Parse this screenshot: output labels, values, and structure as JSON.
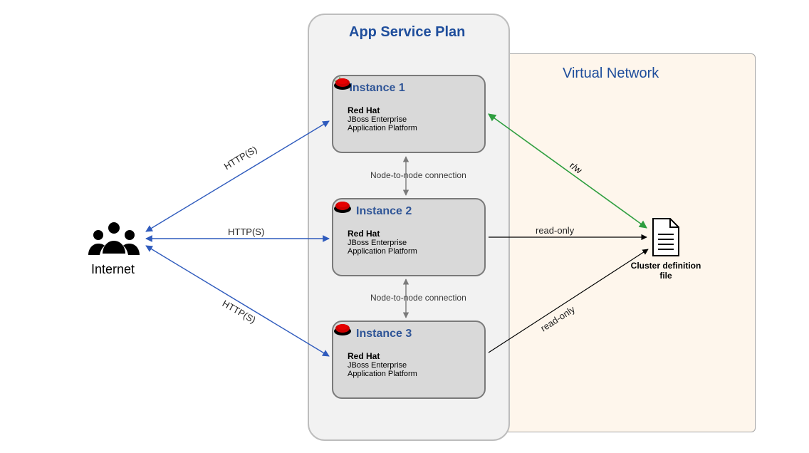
{
  "asp_title": "App Service Plan",
  "vn_title": "Virtual Network",
  "internet_label": "Internet",
  "instances": [
    {
      "title": "Instance 1",
      "vendor": "Red Hat",
      "product1": "JBoss Enterprise",
      "product2": "Application Platform"
    },
    {
      "title": "Instance 2",
      "vendor": "Red Hat",
      "product1": "JBoss Enterprise",
      "product2": "Application Platform"
    },
    {
      "title": "Instance 3",
      "vendor": "Red Hat",
      "product1": "JBoss Enterprise",
      "product2": "Application Platform"
    }
  ],
  "edges": {
    "http1": "HTTP(S)",
    "http2": "HTTP(S)",
    "http3": "HTTP(S)",
    "node_conn": "Node-to-node connection",
    "rw": "r/w",
    "ro1": "read-only",
    "ro2": "read-only"
  },
  "cluster_file_label": "Cluster definition file"
}
